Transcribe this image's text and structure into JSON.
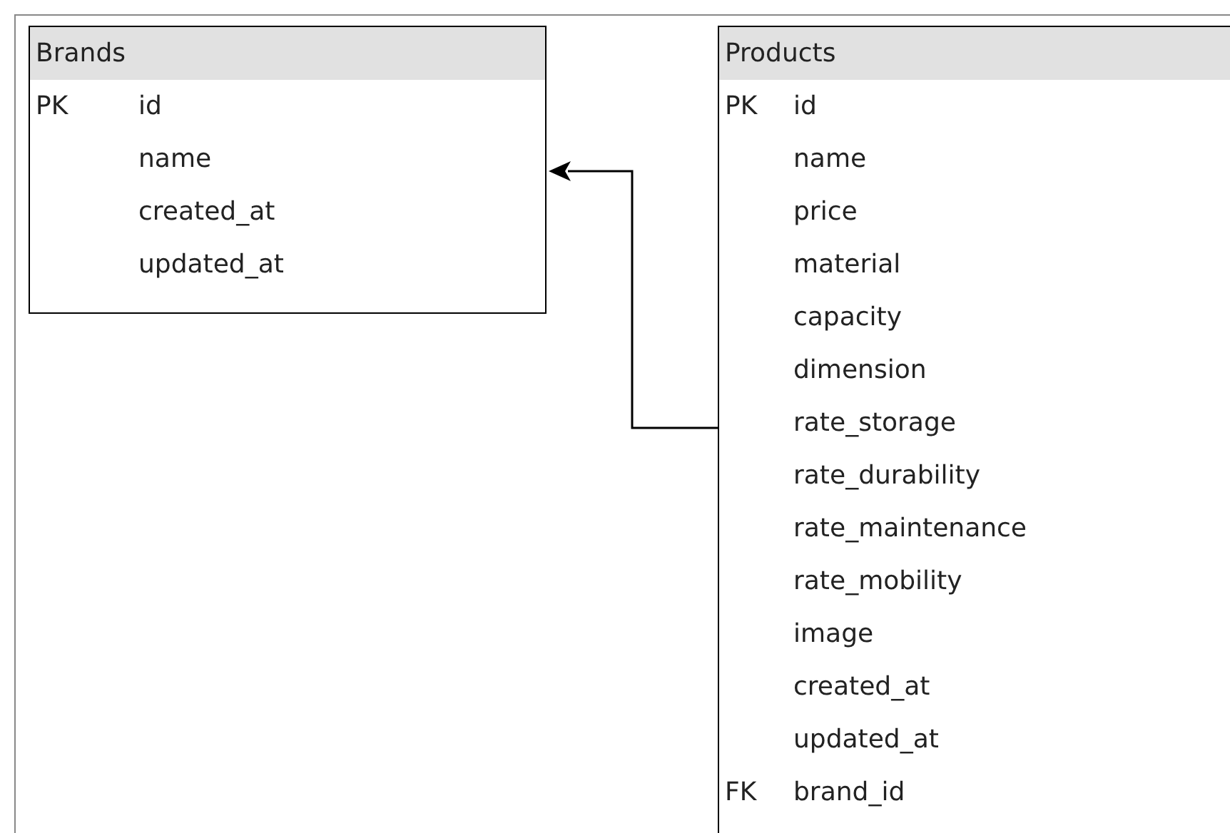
{
  "tables": [
    {
      "name": "Brands",
      "columns": [
        {
          "key": "PK",
          "name": "id"
        },
        {
          "name": "name"
        },
        {
          "name": "created_at"
        },
        {
          "name": "updated_at"
        }
      ]
    },
    {
      "name": "Products",
      "columns": [
        {
          "key": "PK",
          "name": "id"
        },
        {
          "name": "name"
        },
        {
          "name": "price"
        },
        {
          "name": "material"
        },
        {
          "name": "capacity"
        },
        {
          "name": "dimension"
        },
        {
          "name": "rate_storage"
        },
        {
          "name": "rate_durability"
        },
        {
          "name": "rate_maintenance"
        },
        {
          "name": "rate_mobility"
        },
        {
          "name": "image"
        },
        {
          "name": "created_at"
        },
        {
          "name": "updated_at"
        },
        {
          "key": "FK",
          "name": "brand_id"
        }
      ]
    }
  ]
}
